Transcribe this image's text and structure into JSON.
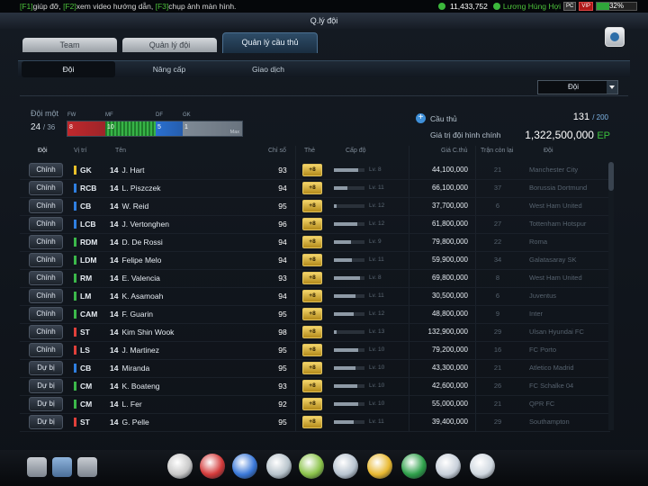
{
  "topbar": {
    "hint": [
      {
        "key": "[F1]",
        "text": "giúp đỡ, "
      },
      {
        "key": "[F2]",
        "text": "xem video hướng dẫn, "
      },
      {
        "key": "[F3]",
        "text": "chụp ảnh màn hình."
      }
    ],
    "gp": "11,433,752",
    "username": "Lương Hùng Hợi",
    "badge_pc": "PC",
    "badge_vip": "VIP",
    "progress": 32,
    "progress_label": "32%"
  },
  "window": {
    "title": "Q.lý đội"
  },
  "tabs": [
    {
      "label": "Team",
      "active": false
    },
    {
      "label": "Quản lý đội",
      "active": false
    },
    {
      "label": "Quản lý cầu thủ",
      "active": true
    }
  ],
  "subtabs": [
    {
      "label": "Đội",
      "active": true
    },
    {
      "label": "Nâng cấp",
      "active": false
    },
    {
      "label": "Giao dịch",
      "active": false
    }
  ],
  "filter": {
    "selected": "Đội"
  },
  "summary": {
    "squad_label": "Đội một",
    "squad_count": "24",
    "squad_total": "/ 36",
    "positions": [
      {
        "label": "FW",
        "count": "8",
        "color": "#c0282c"
      },
      {
        "label": "MF",
        "count": "10",
        "color": "#2ea63c"
      },
      {
        "label": "DF",
        "count": "5",
        "color": "#2a6fd0"
      },
      {
        "label": "GK",
        "count": "1",
        "color": "#7f8a96"
      }
    ],
    "max_label": "Max",
    "players_label": "Cầu thủ",
    "players_count": "131",
    "players_max": "/ 200",
    "value_label": "Giá trị đội hình chính",
    "value": "1,322,500,000",
    "value_unit": "EP"
  },
  "columns": [
    "Đội",
    "Vị trí",
    "Tên",
    "Chỉ số",
    "Thẻ",
    "Cấp độ",
    "Giá C.thủ",
    "Trận còn lại",
    "Đội"
  ],
  "players": [
    {
      "status": "Chính",
      "pos": "GK",
      "pos_color": "#e8c02a",
      "season": "14",
      "name": "J. Hart",
      "ovr": "93",
      "card": "+8",
      "level": "Lv. 8",
      "level_fill": 0.8,
      "value": "44,100,000",
      "games": "21",
      "team": "Manchester City"
    },
    {
      "status": "Chính",
      "pos": "RCB",
      "pos_color": "#2f7fe0",
      "season": "14",
      "name": "L. Piszczek",
      "ovr": "94",
      "card": "+8",
      "level": "Lv. 11",
      "level_fill": 0.45,
      "value": "66,100,000",
      "games": "37",
      "team": "Borussia Dortmund"
    },
    {
      "status": "Chính",
      "pos": "CB",
      "pos_color": "#2f7fe0",
      "season": "14",
      "name": "W. Reid",
      "ovr": "95",
      "card": "+8",
      "level": "Lv. 12",
      "level_fill": 0.1,
      "value": "37,700,000",
      "games": "6",
      "team": "West Ham United"
    },
    {
      "status": "Chính",
      "pos": "LCB",
      "pos_color": "#2f7fe0",
      "season": "14",
      "name": "J. Vertonghen",
      "ovr": "96",
      "card": "+8",
      "level": "Lv. 12",
      "level_fill": 0.75,
      "value": "61,800,000",
      "games": "27",
      "team": "Tottenham Hotspur"
    },
    {
      "status": "Chính",
      "pos": "RDM",
      "pos_color": "#3bb84a",
      "season": "14",
      "name": "D. De Rossi",
      "ovr": "94",
      "card": "+8",
      "level": "Lv. 9",
      "level_fill": 0.55,
      "value": "79,800,000",
      "games": "22",
      "team": "Roma"
    },
    {
      "status": "Chính",
      "pos": "LDM",
      "pos_color": "#3bb84a",
      "season": "14",
      "name": "Felipe Melo",
      "ovr": "94",
      "card": "+8",
      "level": "Lv. 11",
      "level_fill": 0.6,
      "value": "59,900,000",
      "games": "34",
      "team": "Galatasaray SK"
    },
    {
      "status": "Chính",
      "pos": "RM",
      "pos_color": "#3bb84a",
      "season": "14",
      "name": "E. Valencia",
      "ovr": "93",
      "card": "+8",
      "level": "Lv. 8",
      "level_fill": 0.85,
      "value": "69,800,000",
      "games": "8",
      "team": "West Ham United"
    },
    {
      "status": "Chính",
      "pos": "LM",
      "pos_color": "#3bb84a",
      "season": "14",
      "name": "K. Asamoah",
      "ovr": "94",
      "card": "+8",
      "level": "Lv. 11",
      "level_fill": 0.7,
      "value": "30,500,000",
      "games": "6",
      "team": "Juventus"
    },
    {
      "status": "Chính",
      "pos": "CAM",
      "pos_color": "#3bb84a",
      "season": "14",
      "name": "F. Guarin",
      "ovr": "95",
      "card": "+8",
      "level": "Lv. 12",
      "level_fill": 0.65,
      "value": "48,800,000",
      "games": "9",
      "team": "Inter"
    },
    {
      "status": "Chính",
      "pos": "ST",
      "pos_color": "#e0403a",
      "season": "14",
      "name": "Kim Shin Wook",
      "ovr": "98",
      "card": "+8",
      "level": "Lv. 13",
      "level_fill": 0.1,
      "value": "132,900,000",
      "games": "29",
      "team": "Ulsan Hyundai FC"
    },
    {
      "status": "Chính",
      "pos": "LS",
      "pos_color": "#e0403a",
      "season": "14",
      "name": "J. Martinez",
      "ovr": "95",
      "card": "+8",
      "level": "Lv. 10",
      "level_fill": 0.8,
      "value": "79,200,000",
      "games": "16",
      "team": "FC Porto"
    },
    {
      "status": "Dự bị",
      "pos": "CB",
      "pos_color": "#2f7fe0",
      "season": "14",
      "name": "Miranda",
      "ovr": "95",
      "card": "+8",
      "level": "Lv. 10",
      "level_fill": 0.7,
      "value": "43,300,000",
      "games": "21",
      "team": "Atletico Madrid"
    },
    {
      "status": "Dự bị",
      "pos": "CM",
      "pos_color": "#3bb84a",
      "season": "14",
      "name": "K. Boateng",
      "ovr": "93",
      "card": "+8",
      "level": "Lv. 10",
      "level_fill": 0.75,
      "value": "42,600,000",
      "games": "26",
      "team": "FC Schalke 04"
    },
    {
      "status": "Dự bị",
      "pos": "CM",
      "pos_color": "#3bb84a",
      "season": "14",
      "name": "L. Fer",
      "ovr": "92",
      "card": "+8",
      "level": "Lv. 10",
      "level_fill": 0.8,
      "value": "55,000,000",
      "games": "21",
      "team": "QPR FC"
    },
    {
      "status": "Dự bị",
      "pos": "ST",
      "pos_color": "#e0403a",
      "season": "14",
      "name": "G. Pelle",
      "ovr": "95",
      "card": "+8",
      "level": "Lv. 11",
      "level_fill": 0.65,
      "value": "39,400,000",
      "games": "29",
      "team": "Southampton"
    }
  ],
  "bottom_left": [
    {
      "icon": "download-icon",
      "color": "#a8b0b8"
    },
    {
      "icon": "document-icon",
      "color": "#7aa0c8"
    },
    {
      "icon": "mail-icon",
      "color": "#8c949e"
    }
  ],
  "dock": [
    {
      "icon": "contract-icon",
      "color": "#c8c8c8"
    },
    {
      "icon": "lifebuoy-icon",
      "color": "#d33a3a"
    },
    {
      "icon": "boots-icon",
      "color": "#3a78d8"
    },
    {
      "icon": "trophy-icon",
      "color": "#b8c4cc"
    },
    {
      "icon": "pyramid-icon",
      "color": "#8bc34a"
    },
    {
      "icon": "notebook-icon",
      "color": "#b8c4d0"
    },
    {
      "icon": "coin-icon",
      "color": "#e8b830"
    },
    {
      "icon": "club-icon",
      "color": "#2ea04a"
    },
    {
      "icon": "card-icon",
      "color": "#c8d0da"
    },
    {
      "icon": "shopping-cart-icon",
      "color": "#d0d8e0"
    }
  ]
}
